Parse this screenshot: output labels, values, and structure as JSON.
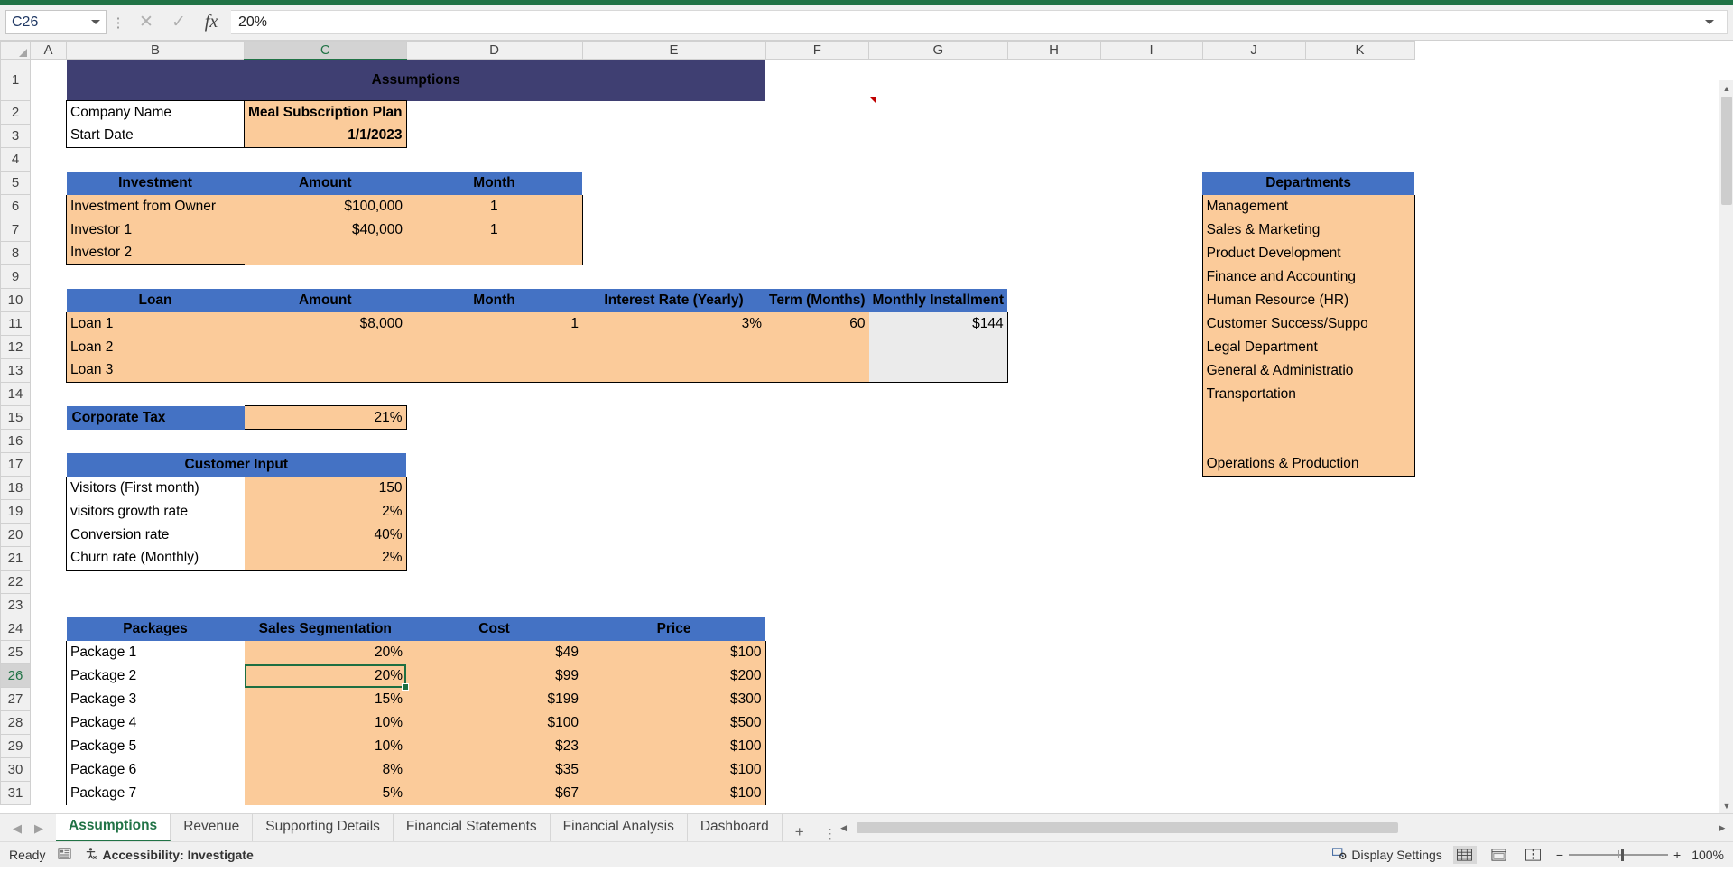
{
  "formula_bar": {
    "name_box": "C26",
    "formula_value": "20%",
    "cancel_icon": "close-icon",
    "confirm_icon": "check-icon",
    "function_icon": "fx-icon"
  },
  "columns": [
    "A",
    "B",
    "C",
    "D",
    "E",
    "F",
    "G",
    "H",
    "I",
    "J",
    "K"
  ],
  "selected_column": "C",
  "selected_row": 26,
  "rows": [
    1,
    2,
    3,
    4,
    5,
    6,
    7,
    8,
    9,
    10,
    11,
    12,
    13,
    14,
    15,
    16,
    17,
    18,
    19,
    20,
    21,
    22,
    23,
    24,
    25,
    26,
    27,
    28,
    29,
    30,
    31
  ],
  "sheet": {
    "title": "Assumptions",
    "company": {
      "label": "Company Name",
      "value": "Meal Subscription Plan"
    },
    "start_date": {
      "label": "Start Date",
      "value": "1/1/2023"
    },
    "investment_table": {
      "headers": [
        "Investment",
        "Amount",
        "Month"
      ],
      "rows": [
        [
          "Investment from Owner",
          "$100,000",
          "1"
        ],
        [
          "Investor 1",
          "$40,000",
          "1"
        ],
        [
          "Investor 2",
          "",
          ""
        ]
      ]
    },
    "loan_table": {
      "headers": [
        "Loan",
        "Amount",
        "Month",
        "Interest Rate (Yearly)",
        "Term (Months)",
        "Monthly Installment"
      ],
      "rows": [
        [
          "Loan 1",
          "$8,000",
          "1",
          "3%",
          "60",
          "$144"
        ],
        [
          "Loan 2",
          "",
          "",
          "",
          "",
          ""
        ],
        [
          "Loan 3",
          "",
          "",
          "",
          "",
          ""
        ]
      ]
    },
    "corporate_tax": {
      "label": "Corporate Tax",
      "value": "21%"
    },
    "customer_input": {
      "header": "Customer Input",
      "rows": [
        [
          "Visitors (First month)",
          "150"
        ],
        [
          "visitors growth rate",
          "2%"
        ],
        [
          "Conversion rate",
          "40%"
        ],
        [
          "Churn rate (Monthly)",
          "2%"
        ]
      ]
    },
    "packages_table": {
      "headers": [
        "Packages",
        "Sales Segmentation",
        "Cost",
        "Price"
      ],
      "rows": [
        [
          "Package 1",
          "20%",
          "$49",
          "$100"
        ],
        [
          "Package 2",
          "20%",
          "$99",
          "$200"
        ],
        [
          "Package 3",
          "15%",
          "$199",
          "$300"
        ],
        [
          "Package 4",
          "10%",
          "$100",
          "$500"
        ],
        [
          "Package 5",
          "10%",
          "$23",
          "$100"
        ],
        [
          "Package 6",
          "8%",
          "$35",
          "$100"
        ],
        [
          "Package 7",
          "5%",
          "$67",
          "$100"
        ]
      ]
    },
    "departments": {
      "header": "Departments",
      "items": [
        "Management",
        "Sales & Marketing",
        "Product Development",
        "Finance and Accounting",
        "Human Resource (HR)",
        "Customer Success/Suppo",
        "Legal Department",
        "General & Administratio",
        "Transportation",
        "",
        "",
        "Operations & Production"
      ]
    }
  },
  "tabs": {
    "prev_icon": "chevron-left-icon",
    "next_icon": "chevron-right-icon",
    "items": [
      "Assumptions",
      "Revenue",
      "Supporting Details",
      "Financial Statements",
      "Financial Analysis",
      "Dashboard"
    ],
    "active": "Assumptions",
    "add_label": "+"
  },
  "status_bar": {
    "state": "Ready",
    "macro_icon": "record-macro-icon",
    "accessibility": "Accessibility: Investigate",
    "display_settings": "Display Settings",
    "views": [
      "normal-view",
      "page-layout-view",
      "page-break-view"
    ],
    "active_view": "normal-view",
    "zoom_out": "−",
    "zoom_in": "+",
    "zoom_level": "100%"
  },
  "colors": {
    "title_bg": "#3f3f72",
    "header_bg": "#4472c4",
    "input_bg": "#fbcb9a",
    "excel_green": "#217346"
  }
}
